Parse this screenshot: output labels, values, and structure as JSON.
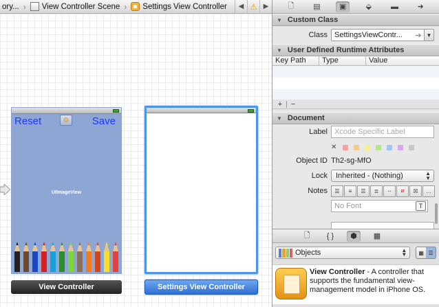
{
  "jumpbar": {
    "crumbs": [
      "ory...",
      "View Controller Scene",
      "Settings View Controller"
    ],
    "warning_glyph": "⚠"
  },
  "canvas": {
    "left_scene": {
      "reset_label": "Reset",
      "save_label": "Save",
      "image_view_label": "UIImageView",
      "footer_label": "View Controller",
      "pencil_colors": [
        "#222222",
        "#6b4a2f",
        "#1849c4",
        "#d61f1f",
        "#19a0d8",
        "#2d8c2b",
        "#7fd63a",
        "#8b6f57",
        "#f07b21",
        "#d2461f",
        "#f5df2a",
        "#e2423e"
      ]
    },
    "right_scene": {
      "footer_label": "Settings View Controller"
    }
  },
  "inspector": {
    "custom_class": {
      "header": "Custom Class",
      "class_label": "Class",
      "class_value": "SettingsViewContr..."
    },
    "runtime_attributes": {
      "header": "User Defined Runtime Attributes",
      "columns": [
        "Key Path",
        "Type",
        "Value"
      ]
    },
    "document": {
      "header": "Document",
      "label_label": "Label",
      "label_placeholder": "Xcode Specific Label",
      "label_colors": [
        "#f7a3a3",
        "#f9c98a",
        "#f7ee8c",
        "#b6e58f",
        "#9fc6f4",
        "#d7a9ef",
        "#c8c8c8"
      ],
      "object_id_label": "Object ID",
      "object_id_value": "Th2-sg-MfO",
      "lock_label": "Lock",
      "lock_value": "Inherited - (Nothing)",
      "notes_label": "Notes",
      "font_placeholder": "No Font"
    }
  },
  "library": {
    "selected_library": "Objects",
    "item": {
      "title": "View Controller",
      "description": " - A controller that supports the fundamental view-management model in iPhone OS."
    }
  }
}
